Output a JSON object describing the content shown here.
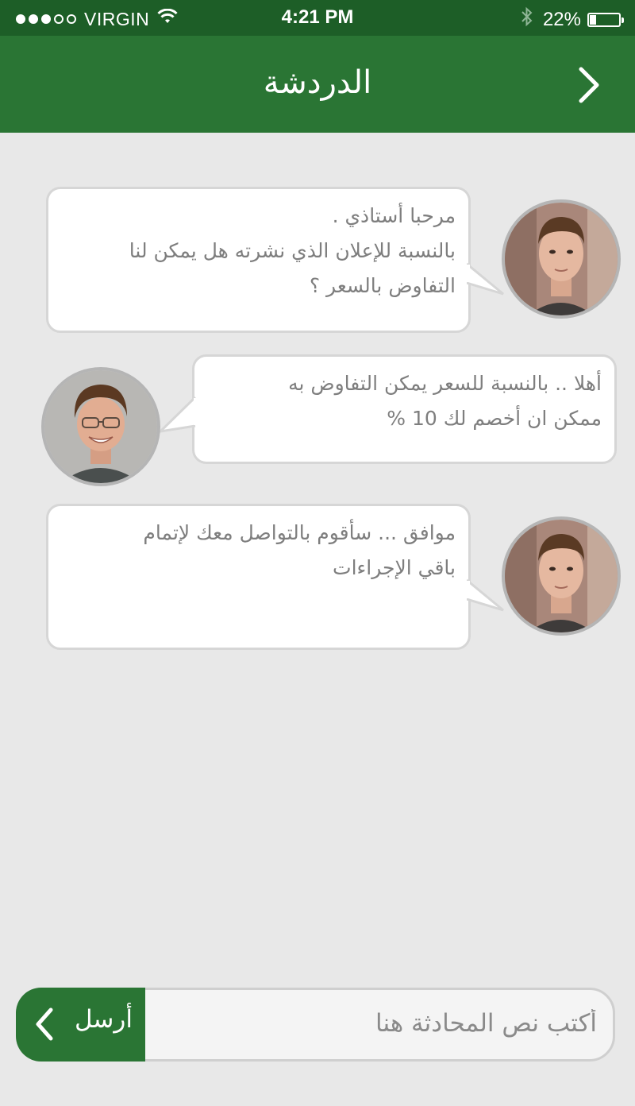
{
  "status_bar": {
    "signal_bars": [
      true,
      true,
      true,
      false,
      false
    ],
    "carrier": "VIRGIN",
    "time": "4:21 PM",
    "battery_percent_text": "22%",
    "battery_level": 0.22,
    "icons": [
      "wifi-icon",
      "bluetooth-icon",
      "battery-icon"
    ]
  },
  "header": {
    "title": "الدردشة",
    "back_icon": "chevron-right-icon",
    "color": "#2a7534"
  },
  "messages": [
    {
      "sender": "other",
      "lines": [
        "مرحبا أستاذي .",
        "بالنسبة للإعلان الذي نشرته هل يمكن لنا",
        "التفاوض بالسعر ؟"
      ]
    },
    {
      "sender": "me",
      "lines": [
        "أهلا .. بالنسبة للسعر يمكن التفاوض به",
        "ممكن ان أخصم لك 10 %"
      ]
    },
    {
      "sender": "other",
      "lines": [
        "موافق ... سأقوم بالتواصل معك لإتمام",
        "باقي الإجراءات"
      ]
    }
  ],
  "composer": {
    "placeholder": "أكتب نص المحادثة هنا",
    "send_label": "أرسل",
    "send_icon": "chevron-left-icon"
  }
}
